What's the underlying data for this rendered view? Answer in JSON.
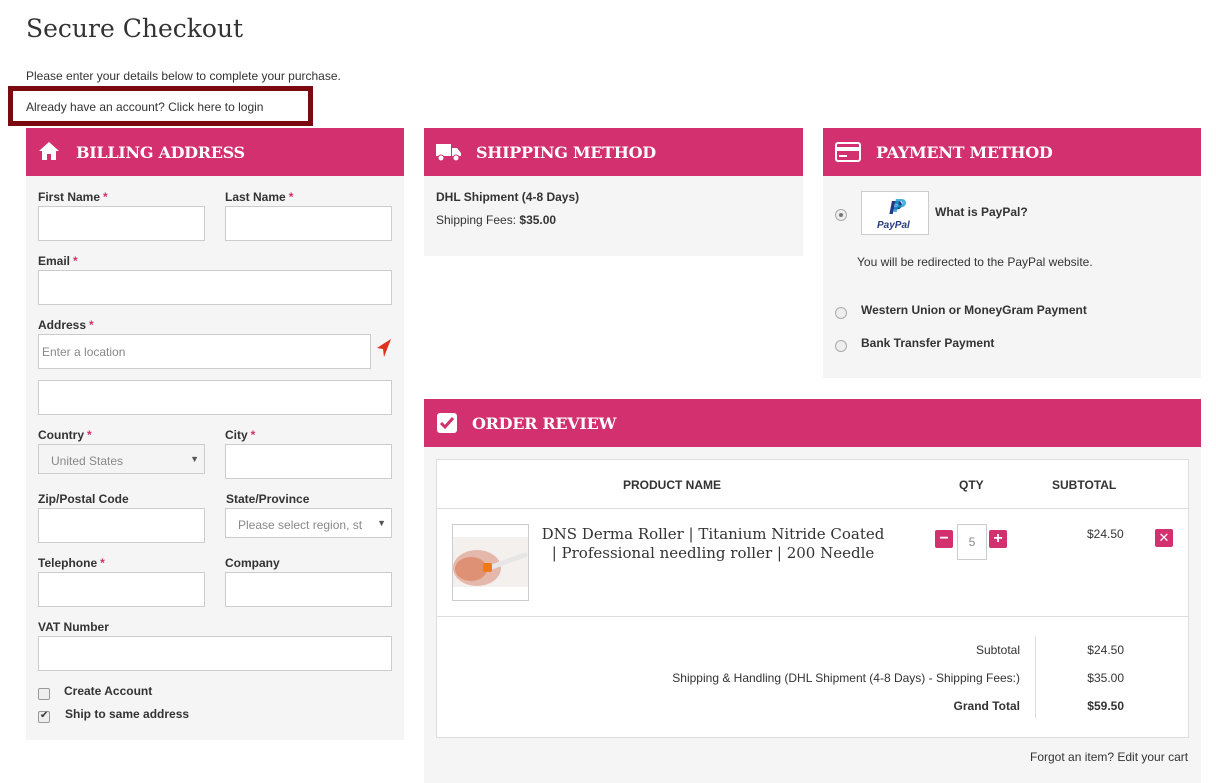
{
  "page": {
    "title": "Secure Checkout",
    "intro": "Please enter your details below to complete your purchase.",
    "login_prompt": "Already have an account? Click here to login"
  },
  "colors": {
    "accent": "#d2306f",
    "login_border": "#7a0a0f",
    "panel_bg": "#f5f5f5"
  },
  "billing": {
    "title": "BILLING ADDRESS",
    "icon": "home-icon",
    "fields": {
      "first_name": "First Name",
      "last_name": "Last Name",
      "email": "Email",
      "address": "Address",
      "address_placeholder": "Enter a location",
      "country": "Country",
      "country_value": "United States",
      "city": "City",
      "zip": "Zip/Postal Code",
      "state": "State/Province",
      "state_placeholder": "Please select region, st",
      "telephone": "Telephone",
      "company": "Company",
      "vat": "VAT Number"
    },
    "required_mark": "*",
    "create_account": "Create Account",
    "create_account_checked": false,
    "ship_same": "Ship to same address",
    "ship_same_checked": true
  },
  "shipping": {
    "title": "SHIPPING METHOD",
    "icon": "truck-icon",
    "method": "DHL Shipment (4-8 Days)",
    "fees_label": "Shipping Fees:",
    "fees_value": "$35.00"
  },
  "payment": {
    "title": "PAYMENT METHOD",
    "icon": "credit-card-icon",
    "paypal_logo_text": "PayPal",
    "paypal_what": "What is PayPal?",
    "paypal_note": "You will be redirected to the PayPal website.",
    "options": [
      {
        "label": "PayPal",
        "selected": true
      },
      {
        "label": "Western Union or MoneyGram Payment",
        "selected": false
      },
      {
        "label": "Bank Transfer Payment",
        "selected": false
      }
    ]
  },
  "review": {
    "title": "ORDER REVIEW",
    "icon": "checkbox-icon",
    "headers": {
      "product": "PRODUCT NAME",
      "qty": "QTY",
      "subtotal": "SUBTOTAL"
    },
    "item": {
      "name": "DNS Derma Roller | Titanium Nitride Coated | Professional needling roller | 200 Needle",
      "qty": "5",
      "price": "$24.50"
    },
    "totals": {
      "subtotal_label": "Subtotal",
      "subtotal_value": "$24.50",
      "shipping_label": "Shipping & Handling (DHL Shipment (4-8 Days) - Shipping Fees:)",
      "shipping_value": "$35.00",
      "grand_label": "Grand Total",
      "grand_value": "$59.50"
    },
    "edit_cart": "Forgot an item? Edit your cart"
  }
}
